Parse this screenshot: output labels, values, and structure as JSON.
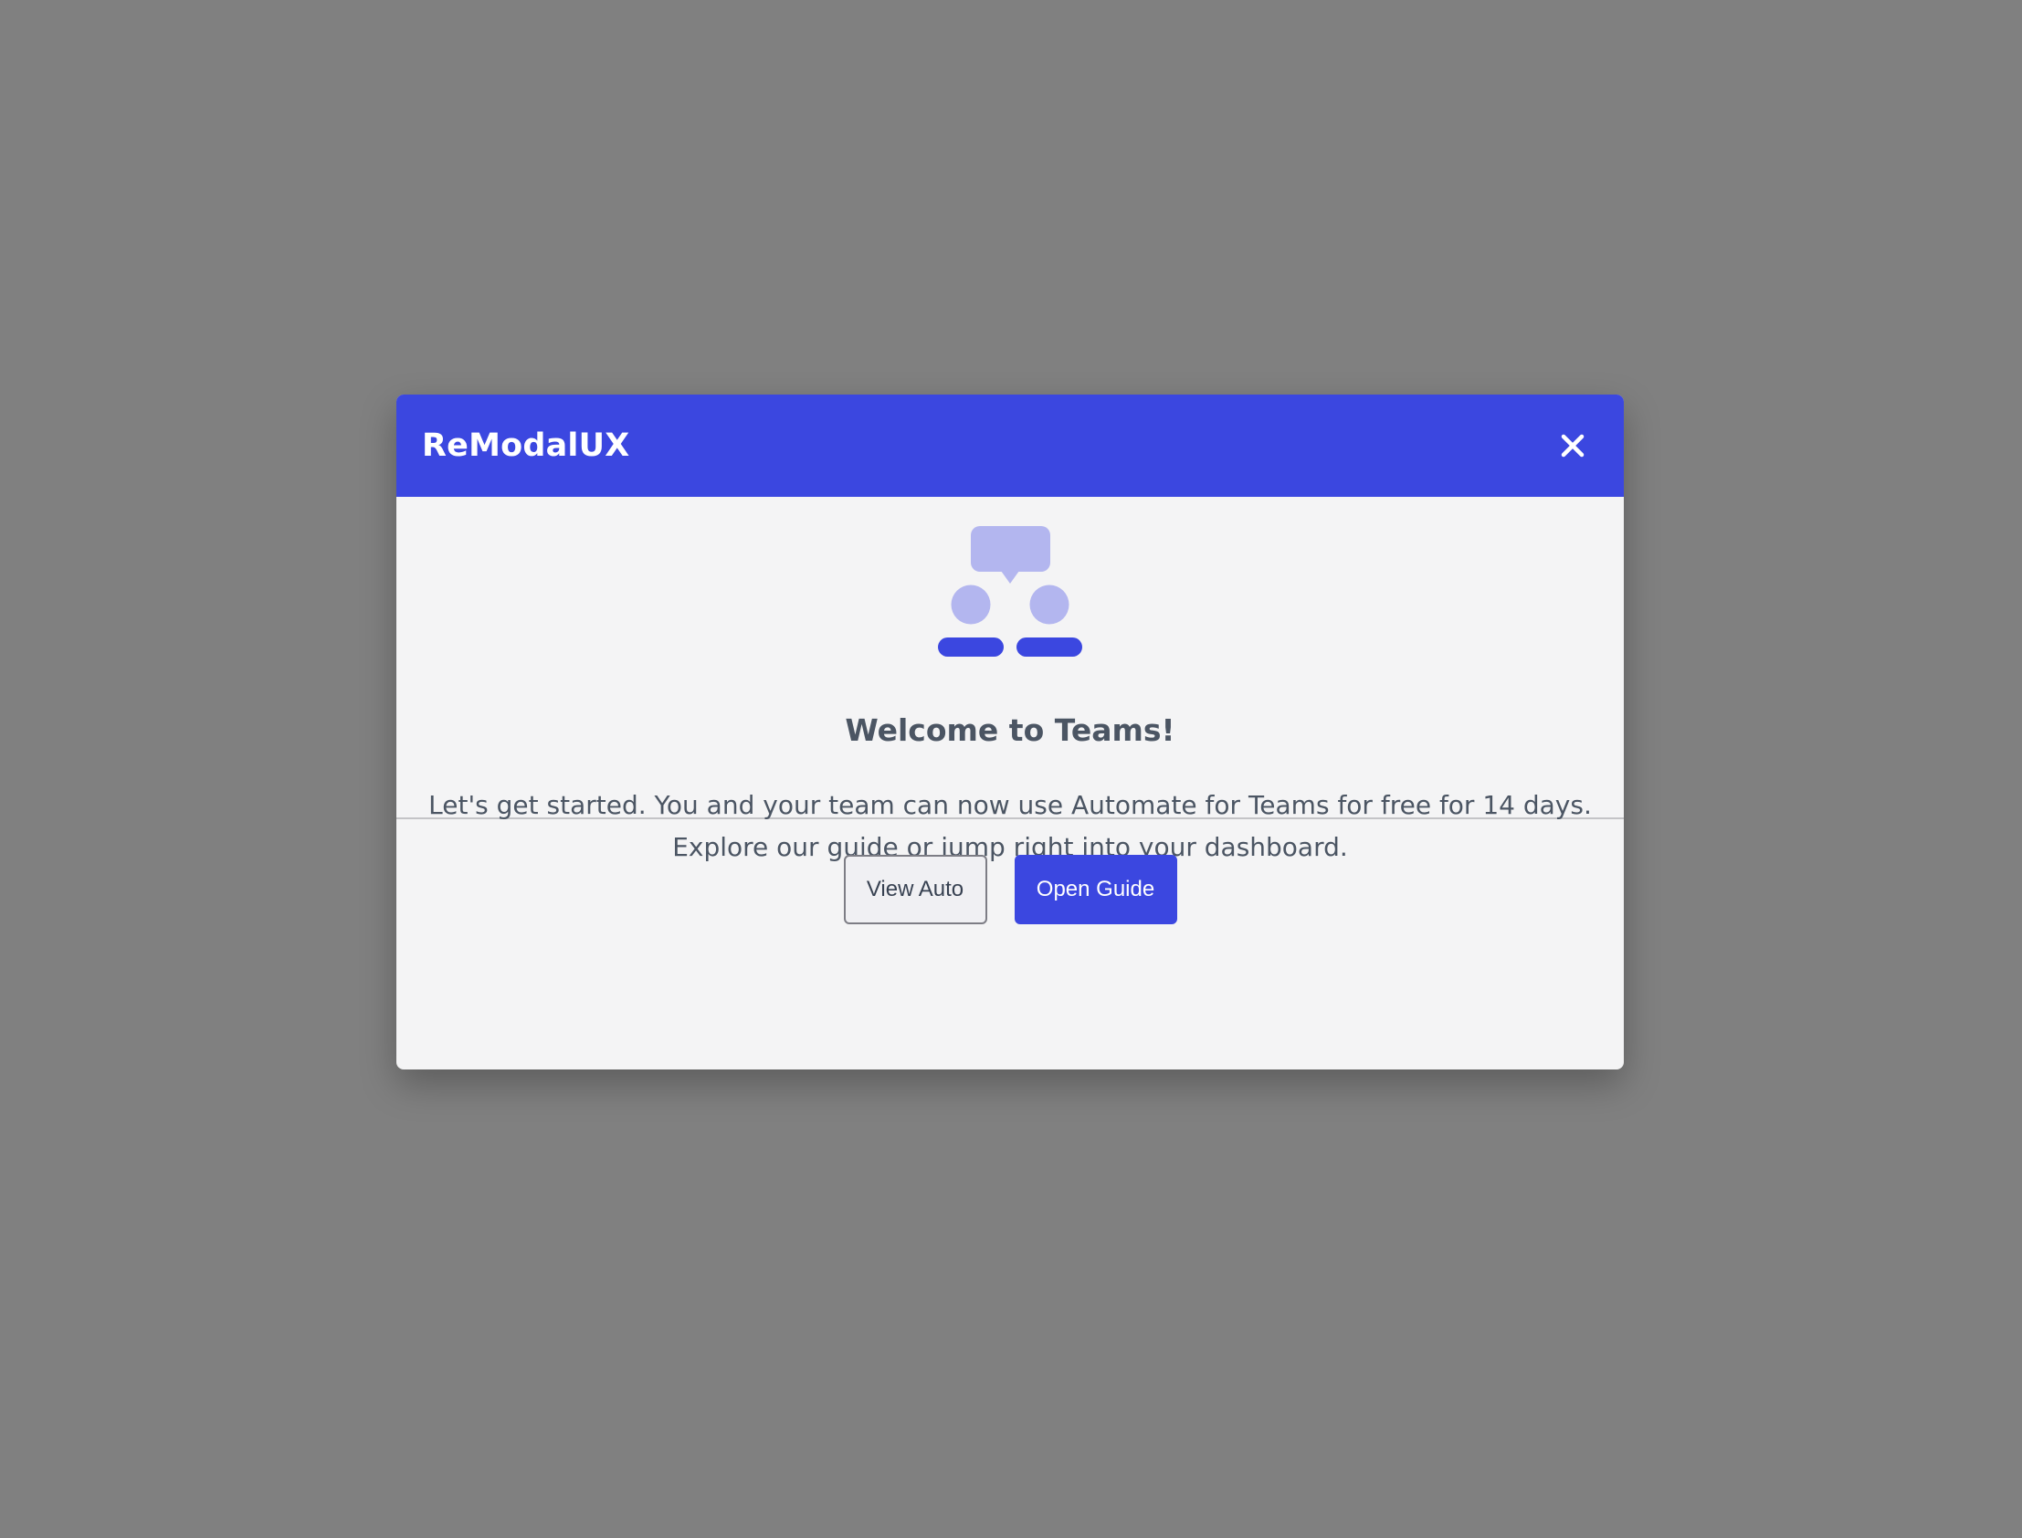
{
  "modal": {
    "title": "ReModalUX",
    "close_icon": "close-icon",
    "illustration_icon": "team-chat-icon",
    "heading": "Welcome to Teams!",
    "body_line1": "Let's get started. You and your team can now use Automate for Teams for free for 14 days.",
    "body_line2": "Explore our guide or jump right into your dashboard."
  },
  "footer": {
    "secondary_label": "View Auto",
    "primary_label": "Open Guide"
  },
  "colors": {
    "accent": "#3b47e0",
    "accent_light": "#b3b6ef",
    "backdrop": "#808080",
    "surface": "#f4f4f5",
    "text": "#4b5563"
  }
}
